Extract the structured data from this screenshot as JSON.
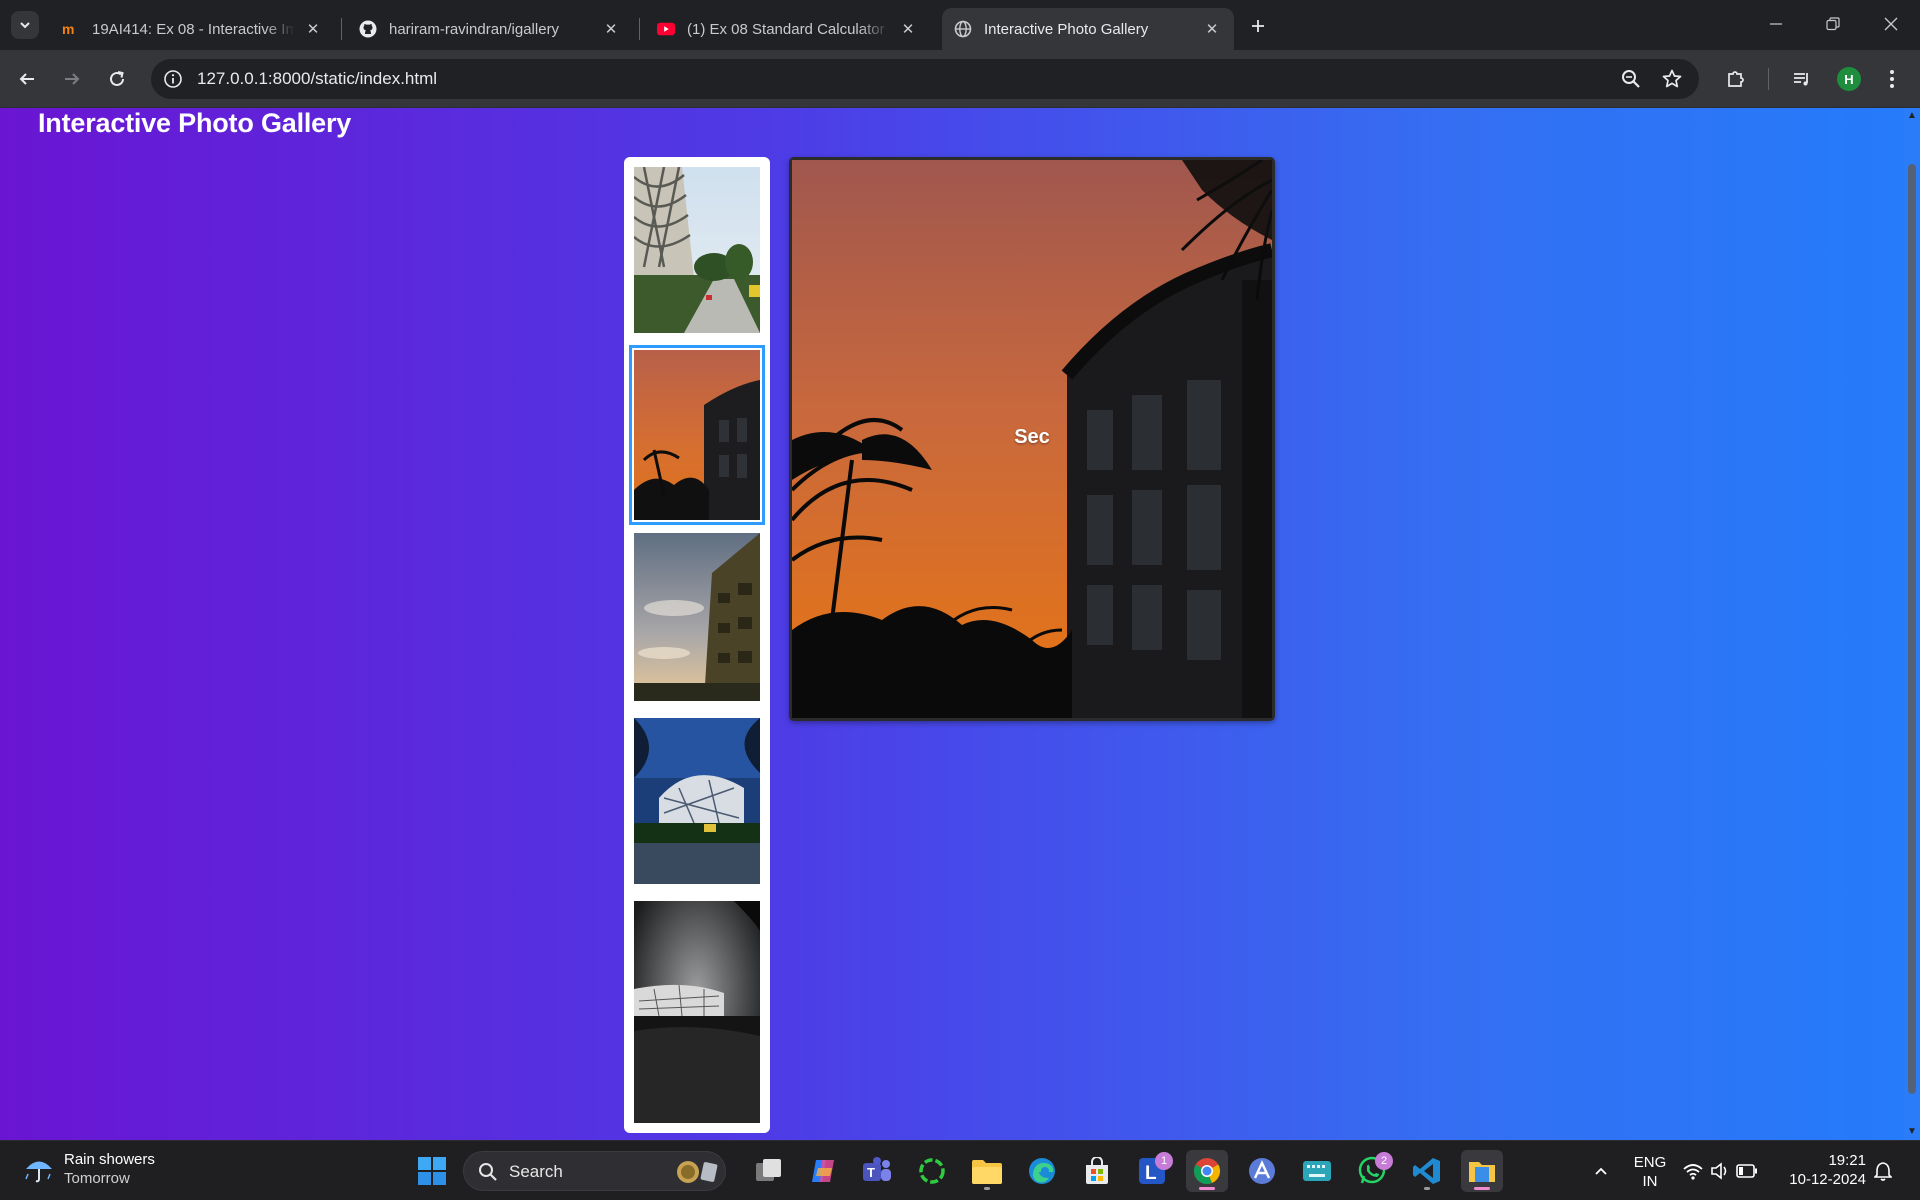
{
  "browser": {
    "tabs": [
      {
        "title": "19AI414: Ex 08 - Interactive Ima",
        "icon": "moodle-icon"
      },
      {
        "title": "hariram-ravindran/igallery",
        "icon": "github-icon"
      },
      {
        "title": "(1) Ex 08 Standard Calculator De",
        "icon": "youtube-icon"
      },
      {
        "title": "Interactive Photo Gallery",
        "icon": "globe-icon",
        "active": true
      }
    ],
    "url": "127.0.0.1:8000/static/index.html",
    "profile_initial": "H"
  },
  "page": {
    "title": "Interactive Photo Gallery",
    "main_caption": "Sec",
    "thumbnails": [
      {
        "subject": "white lattice building with road and palm trees"
      },
      {
        "subject": "sunset sky with palm silhouettes and building",
        "selected": true
      },
      {
        "subject": "building corner against evening clouds"
      },
      {
        "subject": "curved lattice building with palm trees at night"
      },
      {
        "subject": "monochrome building with dark foreground"
      }
    ]
  },
  "taskbar": {
    "weather_main": "Rain showers",
    "weather_sub": "Tomorrow",
    "search_label": "Search",
    "badges": {
      "teams_lync": "1",
      "whatsapp": "2"
    },
    "language_top": "ENG",
    "language_bottom": "IN",
    "time": "19:21",
    "date": "10-12-2024"
  },
  "colors": {
    "gradient_start": "#6a15d2",
    "gradient_end": "#247cfb",
    "selected_outline": "#2f9bff"
  }
}
